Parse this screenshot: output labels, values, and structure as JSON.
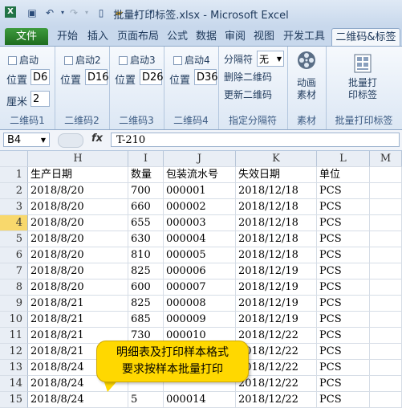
{
  "window": {
    "title": "批量打印标签.xlsx - Microsoft Excel"
  },
  "tabs": [
    "文件",
    "开始",
    "插入",
    "页面布局",
    "公式",
    "数据",
    "审阅",
    "视图",
    "开发工具",
    "二维码&标签"
  ],
  "ribbon": {
    "groups": [
      {
        "label": "二维码1",
        "enable": "启动",
        "pos_label": "位置",
        "pos_value": "D6",
        "cm_label": "厘米",
        "cm_value": "2"
      },
      {
        "label": "二维码2",
        "enable": "启动2",
        "pos_label": "位置",
        "pos_value": "D16"
      },
      {
        "label": "二维码3",
        "enable": "启动3",
        "pos_label": "位置",
        "pos_value": "D26"
      },
      {
        "label": "二维码4",
        "enable": "启动4",
        "pos_label": "位置",
        "pos_value": "D36"
      }
    ],
    "delimiter": {
      "label": "指定分隔符",
      "title": "分隔符",
      "value": "无",
      "delete_btn": "删除二维码",
      "update_btn": "更新二维码"
    },
    "material": {
      "label": "素材",
      "line1": "动画",
      "line2": "素材"
    },
    "batch": {
      "label": "批量打印标签",
      "line1": "批量打",
      "line2": "印标签"
    }
  },
  "formula_bar": {
    "cell": "B4",
    "fx": "fx",
    "value": "T-210"
  },
  "grid": {
    "columns": [
      "H",
      "I",
      "J",
      "K",
      "L",
      "M"
    ],
    "rows": [
      {
        "n": "1",
        "cells": [
          "生产日期",
          "数量",
          "包装流水号",
          "失效日期",
          "单位"
        ]
      },
      {
        "n": "2",
        "cells": [
          "2018/8/20",
          "700",
          "000001",
          "2018/12/18",
          "PCS"
        ]
      },
      {
        "n": "3",
        "cells": [
          "2018/8/20",
          "660",
          "000002",
          "2018/12/18",
          "PCS"
        ]
      },
      {
        "n": "4",
        "cells": [
          "2018/8/20",
          "655",
          "000003",
          "2018/12/18",
          "PCS"
        ]
      },
      {
        "n": "5",
        "cells": [
          "2018/8/20",
          "630",
          "000004",
          "2018/12/18",
          "PCS"
        ]
      },
      {
        "n": "6",
        "cells": [
          "2018/8/20",
          "810",
          "000005",
          "2018/12/18",
          "PCS"
        ]
      },
      {
        "n": "7",
        "cells": [
          "2018/8/20",
          "825",
          "000006",
          "2018/12/19",
          "PCS"
        ]
      },
      {
        "n": "8",
        "cells": [
          "2018/8/20",
          "600",
          "000007",
          "2018/12/19",
          "PCS"
        ]
      },
      {
        "n": "9",
        "cells": [
          "2018/8/21",
          "825",
          "000008",
          "2018/12/19",
          "PCS"
        ]
      },
      {
        "n": "10",
        "cells": [
          "2018/8/21",
          "685",
          "000009",
          "2018/12/19",
          "PCS"
        ]
      },
      {
        "n": "11",
        "cells": [
          "2018/8/21",
          "730",
          "000010",
          "2018/12/22",
          "PCS"
        ]
      },
      {
        "n": "12",
        "cells": [
          "2018/8/21",
          "",
          "",
          "2018/12/22",
          "PCS"
        ]
      },
      {
        "n": "13",
        "cells": [
          "2018/8/24",
          "",
          "",
          "2018/12/22",
          "PCS"
        ]
      },
      {
        "n": "14",
        "cells": [
          "2018/8/24",
          "",
          "",
          "2018/12/22",
          "PCS"
        ]
      },
      {
        "n": "15",
        "cells": [
          "2018/8/24",
          "5",
          "000014",
          "2018/12/22",
          "PCS"
        ]
      }
    ]
  },
  "callout": {
    "line1": "明细表及打印样本格式",
    "line2": "要求按样本批量打印"
  },
  "colors": {
    "file_tab": "#2e8b2e",
    "callout": "#ffd800",
    "selected_row_header": "#f8d86c"
  }
}
